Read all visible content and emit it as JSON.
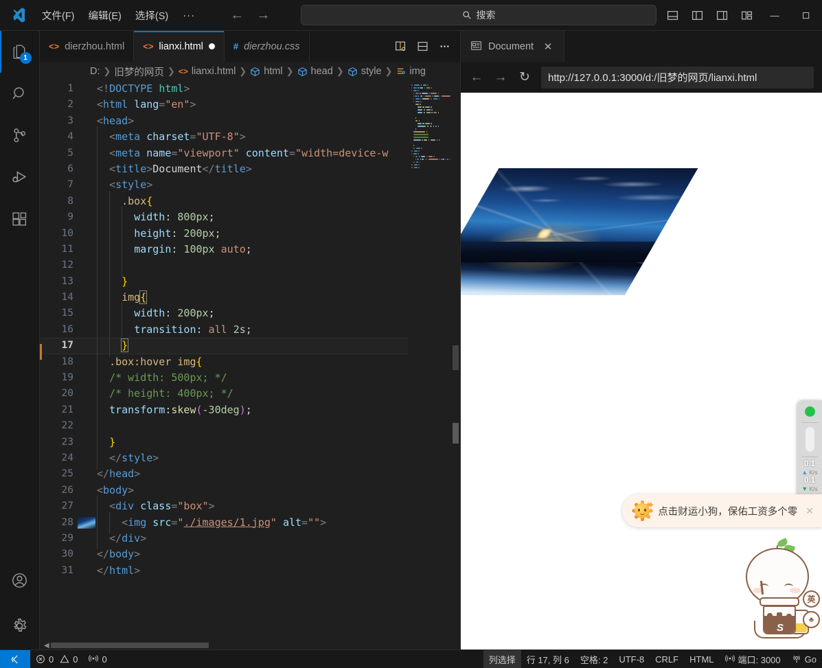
{
  "titlebar": {
    "menus": [
      "文件(F)",
      "编辑(E)",
      "选择(S)"
    ],
    "more": "···",
    "back_arrow": "←",
    "forward_arrow": "→",
    "search_placeholder": "搜索",
    "minimize": "—",
    "layout_icons": [
      "toggle-panel-icon",
      "toggle-sidebar-icon",
      "customize-layout-icon"
    ]
  },
  "activitybar": {
    "items": [
      {
        "name": "explorer",
        "icon": "files-icon",
        "badge": "1",
        "active": true
      },
      {
        "name": "search",
        "icon": "search-icon",
        "badge": "",
        "active": false
      },
      {
        "name": "source-control",
        "icon": "source-control-icon",
        "badge": "",
        "active": false
      },
      {
        "name": "run-debug",
        "icon": "run-debug-icon",
        "badge": "",
        "active": false
      },
      {
        "name": "extensions",
        "icon": "extensions-icon",
        "badge": "",
        "active": false
      }
    ],
    "bottom": [
      {
        "name": "accounts",
        "icon": "account-icon"
      },
      {
        "name": "settings",
        "icon": "gear-icon"
      }
    ]
  },
  "tabs": [
    {
      "label": "dierzhou.html",
      "icon": "html-icon",
      "state": "inactive",
      "dirty": false
    },
    {
      "label": "lianxi.html",
      "icon": "html-icon",
      "state": "active",
      "dirty": true
    },
    {
      "label": "dierzhou.css",
      "icon": "css-icon",
      "state": "preview",
      "dirty": false
    }
  ],
  "tab_actions": [
    "open-preview-icon",
    "split-editor-down-icon",
    "more-actions-icon"
  ],
  "breadcrumbs": [
    {
      "label": "D:",
      "icon": ""
    },
    {
      "label": "旧梦的网页",
      "icon": ""
    },
    {
      "label": "lianxi.html",
      "icon": "html-icon"
    },
    {
      "label": "html",
      "icon": "symbol-icon"
    },
    {
      "label": "head",
      "icon": "symbol-icon"
    },
    {
      "label": "style",
      "icon": "symbol-icon"
    },
    {
      "label": "img",
      "icon": "css-symbol-icon"
    }
  ],
  "editor": {
    "current_line": 17,
    "lines": [
      {
        "n": 1,
        "indent": 0,
        "tokens": [
          {
            "t": "punc",
            "v": "<!"
          },
          {
            "t": "tag",
            "v": "DOCTYPE"
          },
          {
            "t": "plain",
            "v": " "
          },
          {
            "t": "name",
            "v": "html"
          },
          {
            "t": "punc",
            "v": ">"
          }
        ]
      },
      {
        "n": 2,
        "indent": 0,
        "tokens": [
          {
            "t": "punc",
            "v": "<"
          },
          {
            "t": "tag",
            "v": "html"
          },
          {
            "t": "plain",
            "v": " "
          },
          {
            "t": "attr",
            "v": "lang"
          },
          {
            "t": "punc",
            "v": "="
          },
          {
            "t": "str",
            "v": "\"en\""
          },
          {
            "t": "punc",
            "v": ">"
          }
        ]
      },
      {
        "n": 3,
        "indent": 0,
        "tokens": [
          {
            "t": "punc",
            "v": "<"
          },
          {
            "t": "tag",
            "v": "head"
          },
          {
            "t": "punc",
            "v": ">"
          }
        ]
      },
      {
        "n": 4,
        "indent": 1,
        "tokens": [
          {
            "t": "punc",
            "v": "<"
          },
          {
            "t": "tag",
            "v": "meta"
          },
          {
            "t": "plain",
            "v": " "
          },
          {
            "t": "attr",
            "v": "charset"
          },
          {
            "t": "punc",
            "v": "="
          },
          {
            "t": "str",
            "v": "\"UTF-8\""
          },
          {
            "t": "punc",
            "v": ">"
          }
        ]
      },
      {
        "n": 5,
        "indent": 1,
        "tokens": [
          {
            "t": "punc",
            "v": "<"
          },
          {
            "t": "tag",
            "v": "meta"
          },
          {
            "t": "plain",
            "v": " "
          },
          {
            "t": "attr",
            "v": "name"
          },
          {
            "t": "punc",
            "v": "="
          },
          {
            "t": "str",
            "v": "\"viewport\""
          },
          {
            "t": "plain",
            "v": " "
          },
          {
            "t": "attr",
            "v": "content"
          },
          {
            "t": "punc",
            "v": "="
          },
          {
            "t": "str",
            "v": "\"width=device-w"
          }
        ]
      },
      {
        "n": 6,
        "indent": 1,
        "tokens": [
          {
            "t": "punc",
            "v": "<"
          },
          {
            "t": "tag",
            "v": "title"
          },
          {
            "t": "punc",
            "v": ">"
          },
          {
            "t": "plain",
            "v": "Document"
          },
          {
            "t": "punc",
            "v": "</"
          },
          {
            "t": "tag",
            "v": "title"
          },
          {
            "t": "punc",
            "v": ">"
          }
        ]
      },
      {
        "n": 7,
        "indent": 1,
        "tokens": [
          {
            "t": "punc",
            "v": "<"
          },
          {
            "t": "tag",
            "v": "style"
          },
          {
            "t": "punc",
            "v": ">"
          }
        ]
      },
      {
        "n": 8,
        "indent": 2,
        "tokens": [
          {
            "t": "sel",
            "v": ".box"
          },
          {
            "t": "brace",
            "v": "{"
          }
        ]
      },
      {
        "n": 9,
        "indent": 3,
        "tokens": [
          {
            "t": "prop",
            "v": "width"
          },
          {
            "t": "plain",
            "v": ": "
          },
          {
            "t": "num",
            "v": "800px"
          },
          {
            "t": "plain",
            "v": ";"
          }
        ]
      },
      {
        "n": 10,
        "indent": 3,
        "tokens": [
          {
            "t": "prop",
            "v": "height"
          },
          {
            "t": "plain",
            "v": ": "
          },
          {
            "t": "num",
            "v": "200px"
          },
          {
            "t": "plain",
            "v": ";"
          }
        ]
      },
      {
        "n": 11,
        "indent": 3,
        "tokens": [
          {
            "t": "prop",
            "v": "margin"
          },
          {
            "t": "plain",
            "v": ": "
          },
          {
            "t": "num",
            "v": "100px"
          },
          {
            "t": "plain",
            "v": " "
          },
          {
            "t": "kw",
            "v": "auto"
          },
          {
            "t": "plain",
            "v": ";"
          }
        ]
      },
      {
        "n": 12,
        "indent": 3,
        "tokens": []
      },
      {
        "n": 13,
        "indent": 2,
        "tokens": [
          {
            "t": "brace",
            "v": "}"
          }
        ]
      },
      {
        "n": 14,
        "indent": 2,
        "tokens": [
          {
            "t": "sel",
            "v": "img"
          },
          {
            "t": "brace-box",
            "v": "{"
          }
        ]
      },
      {
        "n": 15,
        "indent": 3,
        "tokens": [
          {
            "t": "prop",
            "v": "width"
          },
          {
            "t": "plain",
            "v": ": "
          },
          {
            "t": "num",
            "v": "200px"
          },
          {
            "t": "plain",
            "v": ";"
          }
        ]
      },
      {
        "n": 16,
        "indent": 3,
        "tokens": [
          {
            "t": "prop",
            "v": "transition"
          },
          {
            "t": "plain",
            "v": ": "
          },
          {
            "t": "kw",
            "v": "all"
          },
          {
            "t": "plain",
            "v": " "
          },
          {
            "t": "num",
            "v": "2s"
          },
          {
            "t": "plain",
            "v": ";"
          }
        ]
      },
      {
        "n": 17,
        "indent": 2,
        "tokens": [
          {
            "t": "brace-box",
            "v": "}"
          }
        ]
      },
      {
        "n": 18,
        "indent": 1,
        "tokens": [
          {
            "t": "sel",
            "v": ".box:hover img"
          },
          {
            "t": "brace",
            "v": "{"
          }
        ]
      },
      {
        "n": 19,
        "indent": 1,
        "tokens": [
          {
            "t": "cmt",
            "v": "/* width: 500px; */"
          }
        ]
      },
      {
        "n": 20,
        "indent": 1,
        "tokens": [
          {
            "t": "cmt",
            "v": "/* height: 400px; */"
          }
        ]
      },
      {
        "n": 21,
        "indent": 1,
        "tokens": [
          {
            "t": "prop",
            "v": "transform"
          },
          {
            "t": "plain",
            "v": ":"
          },
          {
            "t": "fn",
            "v": "skew"
          },
          {
            "t": "brace2",
            "v": "("
          },
          {
            "t": "num",
            "v": "-30deg"
          },
          {
            "t": "brace2",
            "v": ")"
          },
          {
            "t": "plain",
            "v": ";"
          }
        ]
      },
      {
        "n": 22,
        "indent": 1,
        "tokens": []
      },
      {
        "n": 23,
        "indent": 1,
        "tokens": [
          {
            "t": "brace",
            "v": "}"
          }
        ]
      },
      {
        "n": 24,
        "indent": 1,
        "tokens": [
          {
            "t": "punc",
            "v": "</"
          },
          {
            "t": "tag",
            "v": "style"
          },
          {
            "t": "punc",
            "v": ">"
          }
        ]
      },
      {
        "n": 25,
        "indent": 0,
        "tokens": [
          {
            "t": "punc",
            "v": "</"
          },
          {
            "t": "tag",
            "v": "head"
          },
          {
            "t": "punc",
            "v": ">"
          }
        ]
      },
      {
        "n": 26,
        "indent": 0,
        "tokens": [
          {
            "t": "punc",
            "v": "<"
          },
          {
            "t": "tag",
            "v": "body"
          },
          {
            "t": "punc",
            "v": ">"
          }
        ]
      },
      {
        "n": 27,
        "indent": 1,
        "tokens": [
          {
            "t": "punc",
            "v": "<"
          },
          {
            "t": "tag",
            "v": "div"
          },
          {
            "t": "plain",
            "v": " "
          },
          {
            "t": "attr",
            "v": "class"
          },
          {
            "t": "punc",
            "v": "="
          },
          {
            "t": "str",
            "v": "\"box\""
          },
          {
            "t": "punc",
            "v": ">"
          }
        ]
      },
      {
        "n": 28,
        "indent": 2,
        "tokens": [
          {
            "t": "punc",
            "v": "<"
          },
          {
            "t": "tag",
            "v": "img"
          },
          {
            "t": "plain",
            "v": " "
          },
          {
            "t": "attr",
            "v": "src"
          },
          {
            "t": "punc",
            "v": "="
          },
          {
            "t": "str",
            "v": "\""
          },
          {
            "t": "link",
            "v": "./images/1.jpg"
          },
          {
            "t": "str",
            "v": "\""
          },
          {
            "t": "plain",
            "v": " "
          },
          {
            "t": "attr",
            "v": "alt"
          },
          {
            "t": "punc",
            "v": "="
          },
          {
            "t": "str",
            "v": "\"\""
          },
          {
            "t": "punc",
            "v": ">"
          }
        ]
      },
      {
        "n": 29,
        "indent": 1,
        "tokens": [
          {
            "t": "punc",
            "v": "</"
          },
          {
            "t": "tag",
            "v": "div"
          },
          {
            "t": "punc",
            "v": ">"
          }
        ]
      },
      {
        "n": 30,
        "indent": 0,
        "tokens": [
          {
            "t": "punc",
            "v": "</"
          },
          {
            "t": "tag",
            "v": "body"
          },
          {
            "t": "punc",
            "v": ">"
          }
        ]
      },
      {
        "n": 31,
        "indent": 0,
        "tokens": [
          {
            "t": "punc",
            "v": "</"
          },
          {
            "t": "tag",
            "v": "html"
          },
          {
            "t": "punc",
            "v": ">"
          }
        ]
      }
    ]
  },
  "browser": {
    "tab_label": "Document",
    "tab_icon": "browser-preview-icon",
    "close": "✕",
    "back": "←",
    "forward": "→",
    "reload": "↻",
    "url": "http://127.0.0.1:3000/d:/旧梦的网页/lianxi.html"
  },
  "net_widget": {
    "status_color": "#21c44a",
    "upload_value": "0.1",
    "upload_unit": "K/s",
    "download_value": "0.1",
    "download_unit": "K/s"
  },
  "toast": {
    "text": "点击财运小狗，保佑工资多个零",
    "close": "✕",
    "icon": "sun-icon"
  },
  "mascot": {
    "name": "sogou-ime-mascot",
    "lang_button": "英",
    "skin_button": "♣",
    "cup_letter": "S"
  },
  "statusbar": {
    "remote_icon": "remote-window-icon",
    "errors": "0",
    "warnings": "0",
    "ports_left": "0",
    "column_select": "列选择",
    "cursor": "行 17, 列 6",
    "spaces": "空格: 2",
    "encoding": "UTF-8",
    "eol": "CRLF",
    "language": "HTML",
    "port": "端口: 3000",
    "go_live": "Go"
  },
  "colors": {
    "accent": "#0078d4",
    "tab_active_bg": "#1f1f1f",
    "titlebar_bg": "#181818",
    "editor_bg": "#1f1f1f",
    "status_bg": "#181818"
  }
}
